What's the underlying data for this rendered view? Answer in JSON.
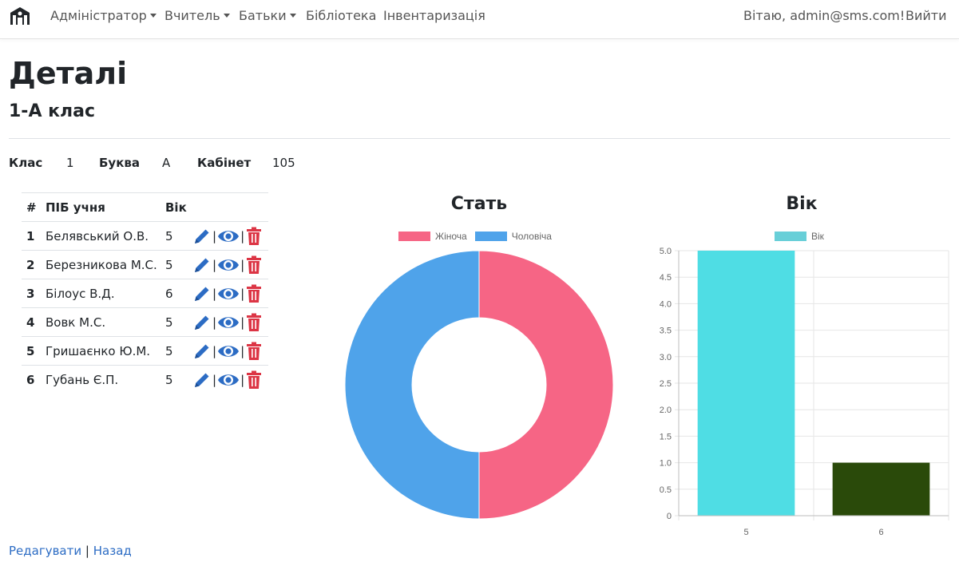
{
  "nav": {
    "admin": "Адміністратор",
    "teacher": "Вчитель",
    "parents": "Батьки",
    "library": "Бібліотека",
    "inventory": "Інвентаризація",
    "greeting": "Вітаю, admin@sms.com!",
    "logout": "Вийти"
  },
  "page": {
    "title": "Деталі",
    "subtitle": "1-А клас"
  },
  "info": {
    "class_label": "Клас",
    "class_value": "1",
    "letter_label": "Буква",
    "letter_value": "А",
    "room_label": "Кабінет",
    "room_value": "105"
  },
  "table": {
    "headers": {
      "num": "#",
      "name": "ПІБ учня",
      "age": "Вік"
    },
    "rows": [
      {
        "num": "1",
        "name": "Белявський О.В.",
        "age": "5"
      },
      {
        "num": "2",
        "name": "Березникова М.С.",
        "age": "5"
      },
      {
        "num": "3",
        "name": "Білоус В.Д.",
        "age": "6"
      },
      {
        "num": "4",
        "name": "Вовк М.С.",
        "age": "5"
      },
      {
        "num": "5",
        "name": "Гришаєнко Ю.М.",
        "age": "5"
      },
      {
        "num": "6",
        "name": "Губань Є.П.",
        "age": "5"
      }
    ],
    "action_icons": [
      "pencil-icon",
      "eye-icon",
      "trash-icon"
    ],
    "separator": "|"
  },
  "colors": {
    "pencil": "#2c6cc4",
    "eye": "#2c6cc4",
    "trash": "#dc3545",
    "link": "#2c6cc4"
  },
  "chart_data": [
    {
      "type": "pie",
      "title": "Стать",
      "categories": [
        "Жіноча",
        "Чоловіча"
      ],
      "values": [
        50,
        50
      ],
      "colors": [
        "#f66585",
        "#4fa3ea"
      ],
      "legend": "top"
    },
    {
      "type": "bar",
      "title": "Вік",
      "categories": [
        "5",
        "6"
      ],
      "series": [
        {
          "name": "Вік",
          "values": [
            5,
            1
          ]
        }
      ],
      "legend_color": "#68cfd8",
      "bar_colors": [
        "#4fdde4",
        "#2a4a0a"
      ],
      "ylim": [
        0,
        5
      ],
      "yticks": [
        "0",
        "0.5",
        "1.0",
        "1.5",
        "2.0",
        "2.5",
        "3.0",
        "3.5",
        "4.0",
        "4.5",
        "5.0"
      ],
      "grid": true,
      "legend": "top"
    }
  ],
  "footer": {
    "edit": "Редагувати",
    "sep": "|",
    "back": "Назад"
  }
}
